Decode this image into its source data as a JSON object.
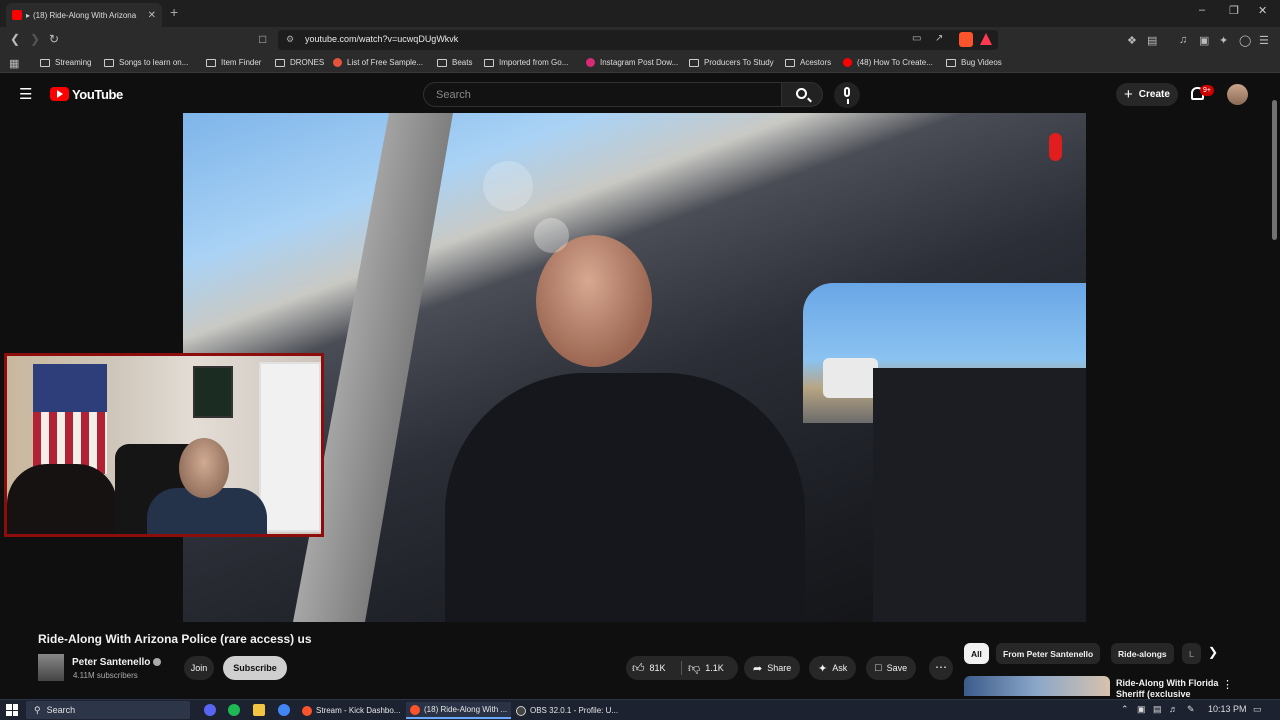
{
  "browser": {
    "tab_title": "(18) Ride-Along With Arizona",
    "url": "youtube.com/watch?v=ucwqDUgWkvk",
    "bookmarks": [
      {
        "label": "Streaming",
        "icon": "folder"
      },
      {
        "label": "Songs to learn on...",
        "icon": "folder"
      },
      {
        "label": "Item Finder",
        "icon": "folder"
      },
      {
        "label": "DRONES",
        "icon": "folder"
      },
      {
        "label": "List of Free Sample...",
        "icon": "site"
      },
      {
        "label": "Beats",
        "icon": "folder"
      },
      {
        "label": "Imported from Go...",
        "icon": "folder"
      },
      {
        "label": "Instagram Post Dow...",
        "icon": "site"
      },
      {
        "label": "Producers To Study",
        "icon": "folder"
      },
      {
        "label": "Acestors",
        "icon": "folder"
      },
      {
        "label": "(48) How To Create...",
        "icon": "youtube"
      },
      {
        "label": "Bug Videos",
        "icon": "folder"
      }
    ]
  },
  "youtube": {
    "logo_text": "YouTube",
    "search_placeholder": "Search",
    "create_label": "Create",
    "notification_count": "9+",
    "video_title": "Ride-Along With Arizona Police (rare access) us",
    "channel": {
      "name": "Peter Santenello",
      "subscribers": "4.11M subscribers",
      "join_label": "Join",
      "subscribe_label": "Subscribe"
    },
    "actions": {
      "likes": "81K",
      "dislikes": "1.1K",
      "share": "Share",
      "ask": "Ask",
      "save": "Save"
    },
    "chips": [
      "All",
      "From Peter Santenello",
      "Ride-alongs",
      "L"
    ],
    "recommendation": {
      "title": "Ride-Along With Florida Sheriff (exclusive"
    }
  },
  "taskbar": {
    "search_label": "Search",
    "apps": [
      "Stream - Kick Dashbo...",
      "(18) Ride-Along With ...",
      "OBS 32.0.1 - Profile: U..."
    ],
    "time": "10:13 PM"
  },
  "colors": {
    "yt_red": "#ff0000",
    "background": "#0f0f0f",
    "webcam_border": "#8d0d0d"
  }
}
